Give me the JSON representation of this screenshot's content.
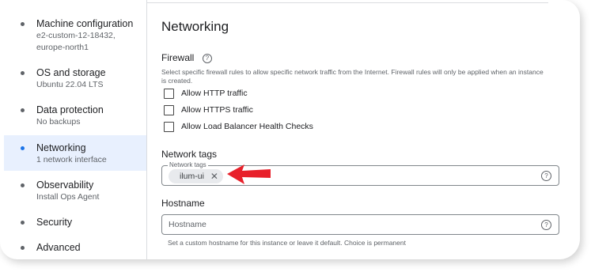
{
  "sidebar": {
    "items": [
      {
        "title": "Machine configuration",
        "sub": "e2-custom-12-18432,",
        "sub2": "europe-north1"
      },
      {
        "title": "OS and storage",
        "sub": "Ubuntu 22.04 LTS"
      },
      {
        "title": "Data protection",
        "sub": "No backups"
      },
      {
        "title": "Networking",
        "sub": "1 network interface"
      },
      {
        "title": "Observability",
        "sub": "Install Ops Agent"
      },
      {
        "title": "Security"
      },
      {
        "title": "Advanced"
      }
    ]
  },
  "main": {
    "title": "Networking",
    "firewall": {
      "heading": "Firewall",
      "help_icon": "?",
      "description": "Select specific firewall rules to allow specific network traffic from the Internet. Firewall rules will only be applied when an instance is created.",
      "options": [
        {
          "label": "Allow HTTP traffic",
          "checked": false
        },
        {
          "label": "Allow HTTPS traffic",
          "checked": false
        },
        {
          "label": "Allow Load Balancer Health Checks",
          "checked": false
        }
      ]
    },
    "network_tags": {
      "heading": "Network tags",
      "field_label": "Network tags",
      "chip": "ilum-ui",
      "chip_remove": "✕",
      "help_icon": "?"
    },
    "hostname": {
      "heading": "Hostname",
      "placeholder": "Hostname",
      "help_icon": "?",
      "hint": "Set a custom hostname for this instance or leave it default. Choice is permanent"
    }
  },
  "colors": {
    "active_bg": "#e8f0fe",
    "accent": "#1a73e8",
    "annotation_arrow": "#e8202a"
  }
}
